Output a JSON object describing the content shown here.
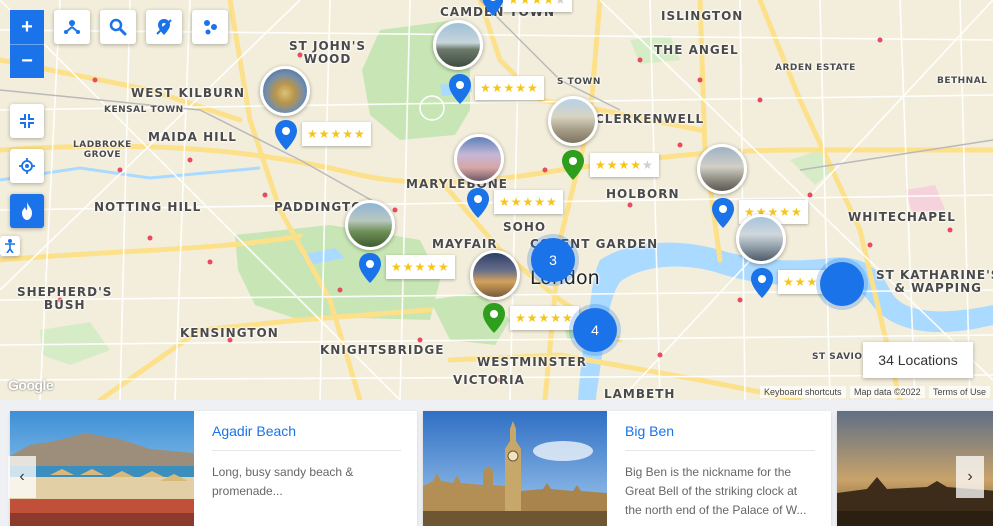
{
  "map": {
    "labels": {
      "camden_town": "CAMDEN TOWN",
      "islington": "ISLINGTON",
      "st_johns_wood": "ST JOHN'S\nWOOD",
      "the_angel": "THE ANGEL",
      "arden_estate": "ARDEN ESTATE",
      "bethnal": "BETHNAL",
      "west_kilburn": "WEST KILBURN",
      "kensal_town": "KENSAL TOWN",
      "maida_hill": "MAIDA HILL",
      "ladbroke_grove": "LADBROKE\nGROVE",
      "clerkenwell": "CLERKENWELL",
      "marylebone": "MARYLEBONE",
      "holborn": "HOLBORN",
      "notting_hill": "NOTTING HILL",
      "paddington": "PADDINGTON",
      "whitechapel": "WHITECHAPEL",
      "soho": "SOHO",
      "mayfair": "MAYFAIR",
      "covent_garden": "COVENT GARDEN",
      "london": "London",
      "st_katharines": "ST KATHARINE'S\n& WAPPING",
      "shepherds_bush": "SHEPHERD'S\nBUSH",
      "kensington": "KENSINGTON",
      "knightsbridge": "KNIGHTSBRIDGE",
      "westminster": "WESTMINSTER",
      "victoria": "VICTORIA",
      "st_saviours": "ST SAVIOUR'S",
      "lambeth": "LAMBETH",
      "st_pancras_town": "S TOWN"
    },
    "ratings": [
      4,
      5,
      5,
      4,
      5,
      5,
      5,
      4,
      5
    ],
    "clusters": [
      "3",
      "4"
    ],
    "location_count": "34 Locations",
    "google_logo": "Google",
    "attribution": {
      "shortcuts": "Keyboard shortcuts",
      "map_data": "Map data ©2022",
      "terms": "Terms of Use"
    },
    "controls": {
      "zoom_in": "+",
      "zoom_out": "−"
    },
    "colors": {
      "accent": "#1a73e8",
      "pin_green": "#2e9e1c",
      "star": "#f5c518",
      "park": "#c8e6b5",
      "water": "#aadaff"
    }
  },
  "carousel": {
    "cards": [
      {
        "title": "Agadir Beach",
        "desc": "Long, busy sandy beach & promenade..."
      },
      {
        "title": "Big Ben",
        "desc": "Big Ben is the nickname for the Great Bell of the striking clock at the north end of the Palace of W..."
      }
    ],
    "prev": "‹",
    "next": "›"
  }
}
